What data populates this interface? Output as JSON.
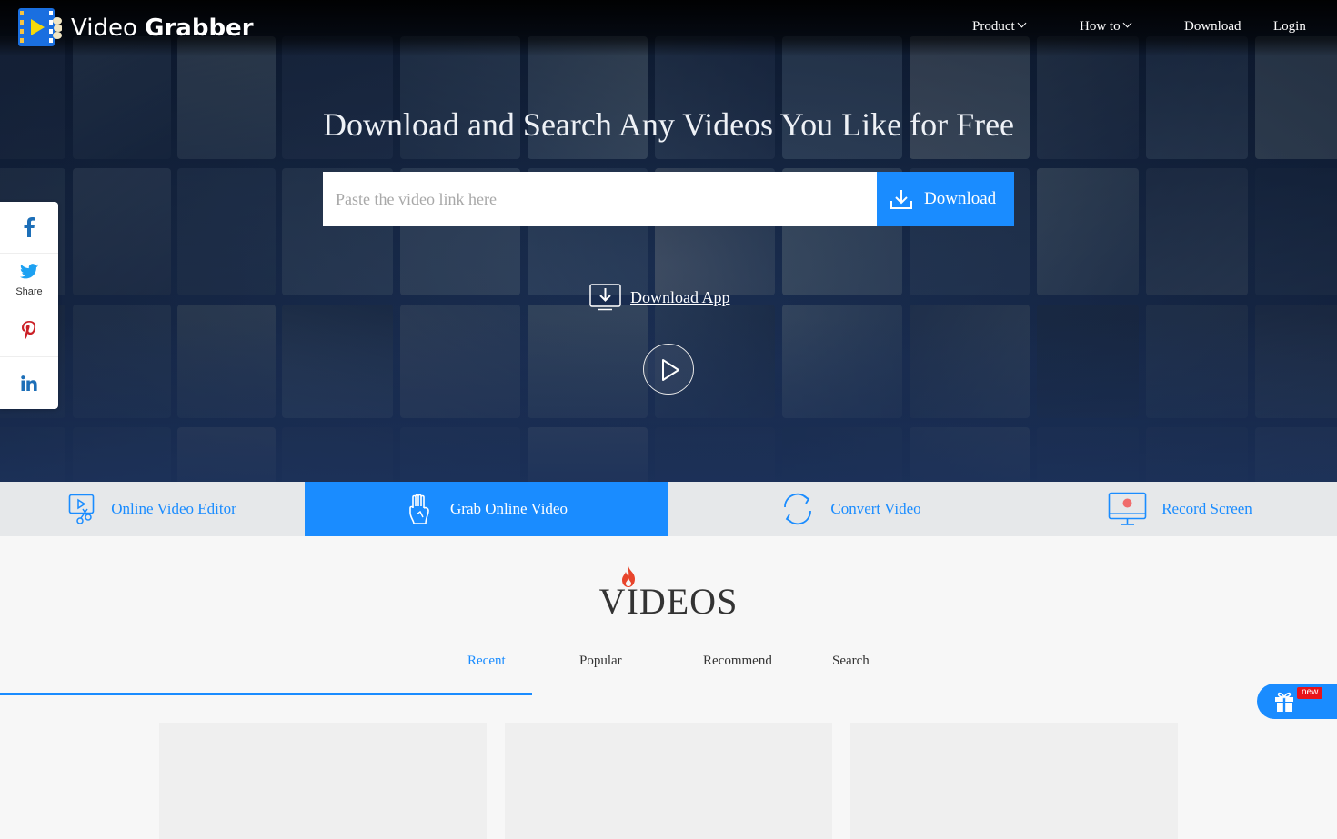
{
  "brand": {
    "name_part1": "Video",
    "name_part2": "Grabber"
  },
  "nav": {
    "items": [
      {
        "label": "Product",
        "dropdown": true
      },
      {
        "label": "How to",
        "dropdown": true
      },
      {
        "label": "Download",
        "dropdown": false
      },
      {
        "label": "Login",
        "dropdown": false
      }
    ]
  },
  "hero": {
    "headline": "Download and Search Any Videos You Like for Free",
    "search_placeholder": "Paste the video link here",
    "search_value": "",
    "download_button": "Download",
    "download_app": "Download App"
  },
  "share": {
    "twitter_label": "Share"
  },
  "features": [
    {
      "label": "Online Video Editor",
      "icon": "video-editor-icon",
      "active": false
    },
    {
      "label": "Grab Online Video",
      "icon": "grab-hand-icon",
      "active": true
    },
    {
      "label": "Convert Video",
      "icon": "convert-arrows-icon",
      "active": false
    },
    {
      "label": "Record Screen",
      "icon": "record-monitor-icon",
      "active": false
    }
  ],
  "videos": {
    "title": "VIDEOS",
    "tabs": [
      "Recent",
      "Popular",
      "Recommend",
      "Search"
    ],
    "active_tab": "Recent"
  },
  "gift": {
    "badge": "new"
  },
  "colors": {
    "accent": "#1a8cff",
    "badge_red": "#e8141b",
    "flame": "#e8452c"
  }
}
